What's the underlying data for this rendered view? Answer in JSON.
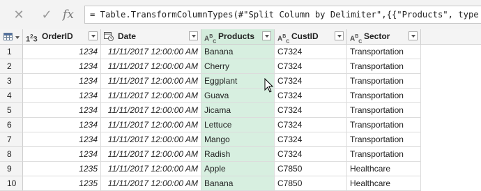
{
  "formula_bar": {
    "cancel_icon": "✕",
    "confirm_icon": "✓",
    "fx_label": "fx",
    "formula": "= Table.TransformColumnTypes(#\"Split Column by Delimiter\",{{\"Products\", type text}})"
  },
  "columns": [
    {
      "type_icon": "123",
      "label": "OrderID"
    },
    {
      "type_icon": "calendar-clock",
      "label": "Date"
    },
    {
      "type_icon": "ABC",
      "label": "Products"
    },
    {
      "type_icon": "ABC",
      "label": "CustID"
    },
    {
      "type_icon": "ABC",
      "label": "Sector"
    }
  ],
  "selected_column": "Products",
  "rows": [
    {
      "idx": "1",
      "order": "1234",
      "date": "11/11/2017 12:00:00 AM",
      "product": "Banana",
      "cust": "C7324",
      "sector": "Transportation"
    },
    {
      "idx": "2",
      "order": "1234",
      "date": "11/11/2017 12:00:00 AM",
      "product": "Cherry",
      "cust": "C7324",
      "sector": "Transportation"
    },
    {
      "idx": "3",
      "order": "1234",
      "date": "11/11/2017 12:00:00 AM",
      "product": "Eggplant",
      "cust": "C7324",
      "sector": "Transportation"
    },
    {
      "idx": "4",
      "order": "1234",
      "date": "11/11/2017 12:00:00 AM",
      "product": "Guava",
      "cust": "C7324",
      "sector": "Transportation"
    },
    {
      "idx": "5",
      "order": "1234",
      "date": "11/11/2017 12:00:00 AM",
      "product": "Jicama",
      "cust": "C7324",
      "sector": "Transportation"
    },
    {
      "idx": "6",
      "order": "1234",
      "date": "11/11/2017 12:00:00 AM",
      "product": "Lettuce",
      "cust": "C7324",
      "sector": "Transportation"
    },
    {
      "idx": "7",
      "order": "1234",
      "date": "11/11/2017 12:00:00 AM",
      "product": "Mango",
      "cust": "C7324",
      "sector": "Transportation"
    },
    {
      "idx": "8",
      "order": "1234",
      "date": "11/11/2017 12:00:00 AM",
      "product": "Radish",
      "cust": "C7324",
      "sector": "Transportation"
    },
    {
      "idx": "9",
      "order": "1235",
      "date": "11/11/2017 12:00:00 AM",
      "product": "Apple",
      "cust": "C7850",
      "sector": "Healthcare"
    },
    {
      "idx": "10",
      "order": "1235",
      "date": "11/11/2017 12:00:00 AM",
      "product": "Banana",
      "cust": "C7850",
      "sector": "Healthcare"
    }
  ],
  "colors": {
    "selected_column": "#d7efe0",
    "header_bg": "#f4f4f4",
    "formula_bar_bg": "#f3f3f3"
  }
}
